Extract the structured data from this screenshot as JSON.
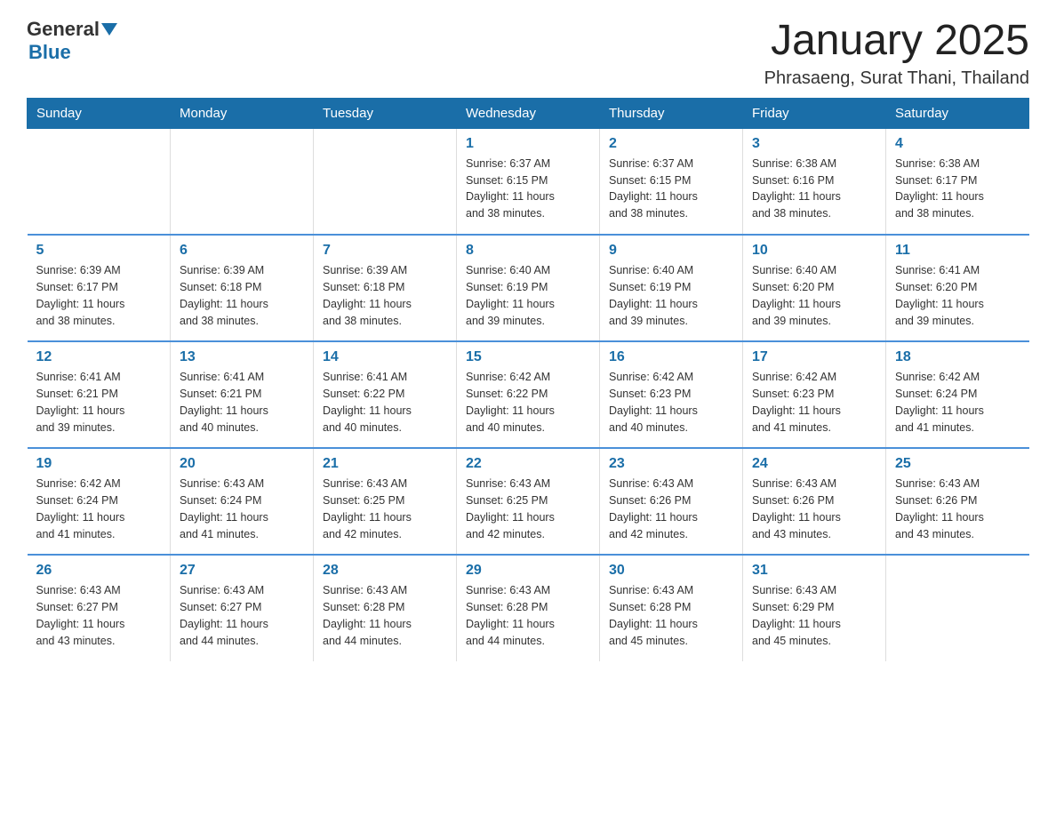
{
  "header": {
    "logo_general": "General",
    "logo_blue": "Blue",
    "title": "January 2025",
    "subtitle": "Phrasaeng, Surat Thani, Thailand"
  },
  "weekdays": [
    "Sunday",
    "Monday",
    "Tuesday",
    "Wednesday",
    "Thursday",
    "Friday",
    "Saturday"
  ],
  "weeks": [
    [
      {
        "day": "",
        "info": ""
      },
      {
        "day": "",
        "info": ""
      },
      {
        "day": "",
        "info": ""
      },
      {
        "day": "1",
        "info": "Sunrise: 6:37 AM\nSunset: 6:15 PM\nDaylight: 11 hours\nand 38 minutes."
      },
      {
        "day": "2",
        "info": "Sunrise: 6:37 AM\nSunset: 6:15 PM\nDaylight: 11 hours\nand 38 minutes."
      },
      {
        "day": "3",
        "info": "Sunrise: 6:38 AM\nSunset: 6:16 PM\nDaylight: 11 hours\nand 38 minutes."
      },
      {
        "day": "4",
        "info": "Sunrise: 6:38 AM\nSunset: 6:17 PM\nDaylight: 11 hours\nand 38 minutes."
      }
    ],
    [
      {
        "day": "5",
        "info": "Sunrise: 6:39 AM\nSunset: 6:17 PM\nDaylight: 11 hours\nand 38 minutes."
      },
      {
        "day": "6",
        "info": "Sunrise: 6:39 AM\nSunset: 6:18 PM\nDaylight: 11 hours\nand 38 minutes."
      },
      {
        "day": "7",
        "info": "Sunrise: 6:39 AM\nSunset: 6:18 PM\nDaylight: 11 hours\nand 38 minutes."
      },
      {
        "day": "8",
        "info": "Sunrise: 6:40 AM\nSunset: 6:19 PM\nDaylight: 11 hours\nand 39 minutes."
      },
      {
        "day": "9",
        "info": "Sunrise: 6:40 AM\nSunset: 6:19 PM\nDaylight: 11 hours\nand 39 minutes."
      },
      {
        "day": "10",
        "info": "Sunrise: 6:40 AM\nSunset: 6:20 PM\nDaylight: 11 hours\nand 39 minutes."
      },
      {
        "day": "11",
        "info": "Sunrise: 6:41 AM\nSunset: 6:20 PM\nDaylight: 11 hours\nand 39 minutes."
      }
    ],
    [
      {
        "day": "12",
        "info": "Sunrise: 6:41 AM\nSunset: 6:21 PM\nDaylight: 11 hours\nand 39 minutes."
      },
      {
        "day": "13",
        "info": "Sunrise: 6:41 AM\nSunset: 6:21 PM\nDaylight: 11 hours\nand 40 minutes."
      },
      {
        "day": "14",
        "info": "Sunrise: 6:41 AM\nSunset: 6:22 PM\nDaylight: 11 hours\nand 40 minutes."
      },
      {
        "day": "15",
        "info": "Sunrise: 6:42 AM\nSunset: 6:22 PM\nDaylight: 11 hours\nand 40 minutes."
      },
      {
        "day": "16",
        "info": "Sunrise: 6:42 AM\nSunset: 6:23 PM\nDaylight: 11 hours\nand 40 minutes."
      },
      {
        "day": "17",
        "info": "Sunrise: 6:42 AM\nSunset: 6:23 PM\nDaylight: 11 hours\nand 41 minutes."
      },
      {
        "day": "18",
        "info": "Sunrise: 6:42 AM\nSunset: 6:24 PM\nDaylight: 11 hours\nand 41 minutes."
      }
    ],
    [
      {
        "day": "19",
        "info": "Sunrise: 6:42 AM\nSunset: 6:24 PM\nDaylight: 11 hours\nand 41 minutes."
      },
      {
        "day": "20",
        "info": "Sunrise: 6:43 AM\nSunset: 6:24 PM\nDaylight: 11 hours\nand 41 minutes."
      },
      {
        "day": "21",
        "info": "Sunrise: 6:43 AM\nSunset: 6:25 PM\nDaylight: 11 hours\nand 42 minutes."
      },
      {
        "day": "22",
        "info": "Sunrise: 6:43 AM\nSunset: 6:25 PM\nDaylight: 11 hours\nand 42 minutes."
      },
      {
        "day": "23",
        "info": "Sunrise: 6:43 AM\nSunset: 6:26 PM\nDaylight: 11 hours\nand 42 minutes."
      },
      {
        "day": "24",
        "info": "Sunrise: 6:43 AM\nSunset: 6:26 PM\nDaylight: 11 hours\nand 43 minutes."
      },
      {
        "day": "25",
        "info": "Sunrise: 6:43 AM\nSunset: 6:26 PM\nDaylight: 11 hours\nand 43 minutes."
      }
    ],
    [
      {
        "day": "26",
        "info": "Sunrise: 6:43 AM\nSunset: 6:27 PM\nDaylight: 11 hours\nand 43 minutes."
      },
      {
        "day": "27",
        "info": "Sunrise: 6:43 AM\nSunset: 6:27 PM\nDaylight: 11 hours\nand 44 minutes."
      },
      {
        "day": "28",
        "info": "Sunrise: 6:43 AM\nSunset: 6:28 PM\nDaylight: 11 hours\nand 44 minutes."
      },
      {
        "day": "29",
        "info": "Sunrise: 6:43 AM\nSunset: 6:28 PM\nDaylight: 11 hours\nand 44 minutes."
      },
      {
        "day": "30",
        "info": "Sunrise: 6:43 AM\nSunset: 6:28 PM\nDaylight: 11 hours\nand 45 minutes."
      },
      {
        "day": "31",
        "info": "Sunrise: 6:43 AM\nSunset: 6:29 PM\nDaylight: 11 hours\nand 45 minutes."
      },
      {
        "day": "",
        "info": ""
      }
    ]
  ]
}
